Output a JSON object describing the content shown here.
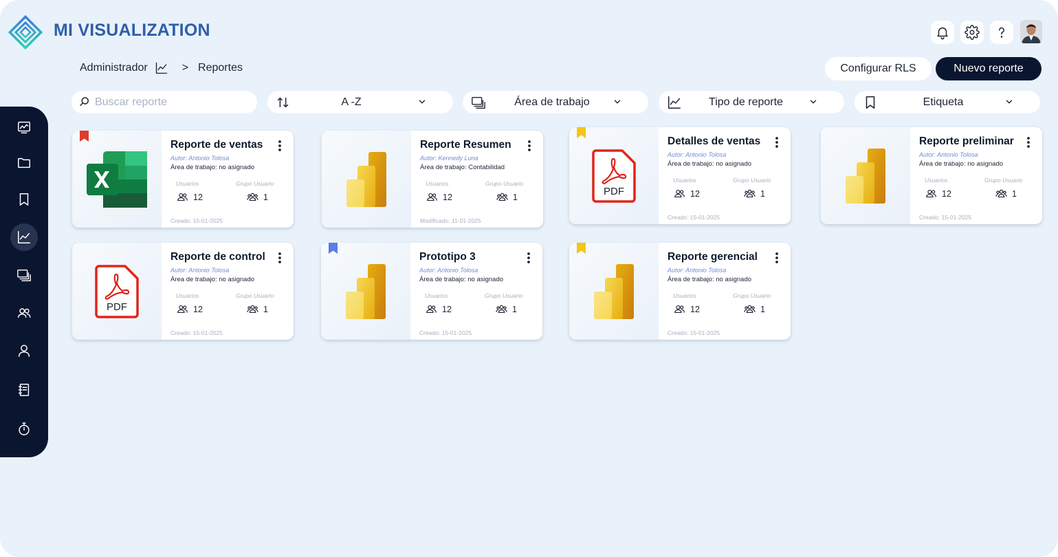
{
  "brand": {
    "name": "MI VISUALIZATION"
  },
  "header": {
    "icons": [
      "bell-icon",
      "gear-icon",
      "help-icon"
    ],
    "breadcrumb": {
      "root": "Administrador",
      "separator": ">",
      "current": "Reportes"
    },
    "actions": {
      "configure_rls": "Configurar RLS",
      "new_report": "Nuevo reporte"
    }
  },
  "sidebar": {
    "items": [
      {
        "icon": "dashboard-icon"
      },
      {
        "icon": "folder-icon"
      },
      {
        "icon": "bookmark-icon"
      },
      {
        "icon": "chart-icon",
        "active": true
      },
      {
        "icon": "workspaces-icon"
      },
      {
        "icon": "groups-icon"
      },
      {
        "icon": "user-icon"
      },
      {
        "icon": "notebook-icon"
      },
      {
        "icon": "stopwatch-icon"
      }
    ]
  },
  "filters": {
    "search_placeholder": "Buscar reporte",
    "sort": "A -Z",
    "workspace": "Área de trabajo",
    "report_type": "Tipo de reporte",
    "tag": "Etiqueta"
  },
  "labels": {
    "users": "Usuarios",
    "groups": "Grupo Usuario"
  },
  "colors": {
    "navy": "#0a1530",
    "brand": "#2f5fa8",
    "tag_red": "#e03a2b",
    "tag_yellow": "#f5c518",
    "tag_blue": "#5a7ee6"
  },
  "cards": [
    {
      "title": "Reporte de ventas",
      "author": "Autor: Antonio Tolosa",
      "workspace": "Área de trabajo: no asignado",
      "users": "12",
      "groups": "1",
      "date": "Creado: 15-01-2025",
      "type": "excel",
      "tag": "red"
    },
    {
      "title": "Reporte Resumen",
      "author": "Autor: Kennedy Luna",
      "workspace": "Área de trabajo: Contabilidad",
      "users": "12",
      "groups": "1",
      "date": "Modificado: 11-01-2025",
      "type": "powerbi",
      "tag": null
    },
    {
      "title": "Detalles de ventas",
      "author": "Autor: Antonio Tolosa",
      "workspace": "Área de trabajo: no asignado",
      "users": "12",
      "groups": "1",
      "date": "Creado: 15-01-2025",
      "type": "pdf",
      "tag": "yellow"
    },
    {
      "title": "Reporte preliminar",
      "author": "Autor: Antonio Tolosa",
      "workspace": "Área de trabajo: no asignado",
      "users": "12",
      "groups": "1",
      "date": "Creado: 15-01-2025",
      "type": "powerbi",
      "tag": null
    },
    {
      "title": "Reporte de control",
      "author": "Autor: Antonio Tolosa",
      "workspace": "Área de trabajo: no asignado",
      "users": "12",
      "groups": "1",
      "date": "Creado: 15-01-2025",
      "type": "pdf",
      "tag": null
    },
    {
      "title": "Prototipo 3",
      "author": "Autor: Antonio Tolosa",
      "workspace": "Área de trabajo: no asignado",
      "users": "12",
      "groups": "1",
      "date": "Creado: 15-01-2025",
      "type": "powerbi",
      "tag": "blue"
    },
    {
      "title": "Reporte gerencial",
      "author": "Autor: Antonio Tolosa",
      "workspace": "Área de trabajo: no asignado",
      "users": "12",
      "groups": "1",
      "date": "Creado: 15-01-2025",
      "type": "powerbi",
      "tag": "yellow"
    }
  ]
}
